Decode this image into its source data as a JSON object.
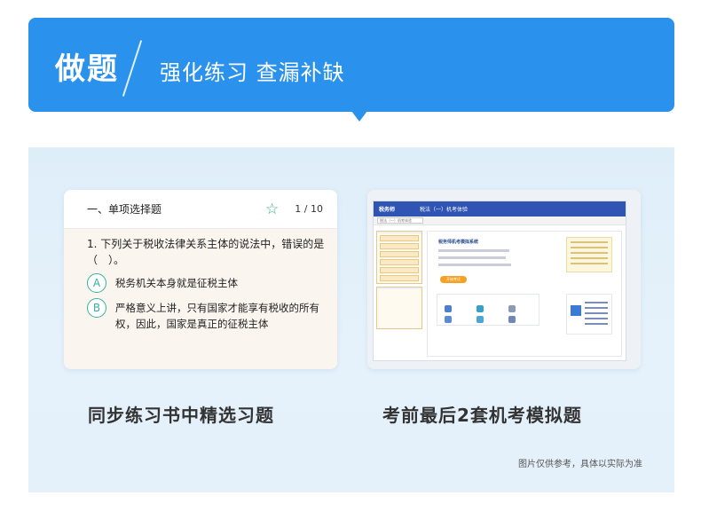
{
  "banner": {
    "main": "做题",
    "sub": "强化练习 查漏补缺"
  },
  "question_card": {
    "section": "一、单项选择题",
    "count": "1 / 10",
    "question": "1. 下列关于税收法律关系主体的说法中，错误的是（　）。",
    "options": [
      {
        "letter": "A",
        "text": "税务机关本身就是征税主体"
      },
      {
        "letter": "B",
        "text": "严格意义上讲，只有国家才能享有税收的所有权，因此，国家是真正的征税主体"
      }
    ]
  },
  "mini_page": {
    "brand": "税务师",
    "nav_title": "税法（一）机考体验",
    "select_value": "税法（一）机考体验",
    "headline": "税务师机考模拟系统",
    "start_button": "开始考试"
  },
  "captions": {
    "left": "同步练习书中精选习题",
    "right": "考前最后2套机考模拟题"
  },
  "note": "图片仅供参考，具体以实际为准",
  "colors": {
    "banner": "#2a91ec",
    "option_accent": "#35b29b",
    "star": "#36b37e"
  }
}
